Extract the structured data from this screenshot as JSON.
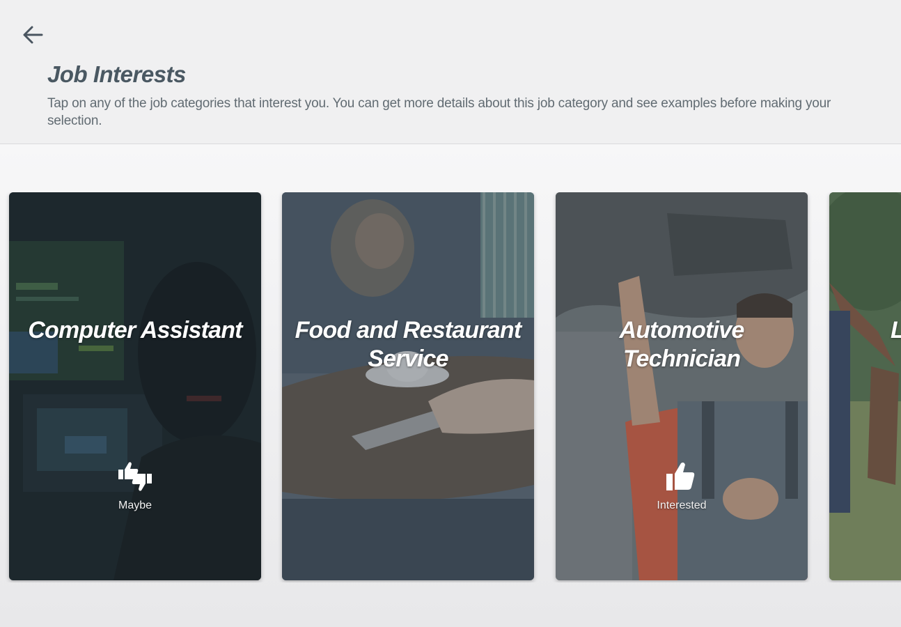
{
  "header": {
    "back_label": "Back",
    "title": "Job Interests",
    "description": "Tap on any of the job categories that interest you.  You can get more details about this job category and see examples before making your selection."
  },
  "cards": [
    {
      "title": "Computer Assistant",
      "status": "Maybe",
      "status_icon": "thumbs-up-down-icon"
    },
    {
      "title": "Food and Restaurant Service",
      "status": "",
      "status_icon": ""
    },
    {
      "title": "Automotive Technician",
      "status": "Interested",
      "status_icon": "thumbs-up-icon"
    },
    {
      "title": "L",
      "status": "",
      "status_icon": ""
    }
  ],
  "colors": {
    "title_text": "#4a5862",
    "body_text": "#616b72",
    "header_bg": "#f0f0f1",
    "card_text": "#ffffff"
  }
}
